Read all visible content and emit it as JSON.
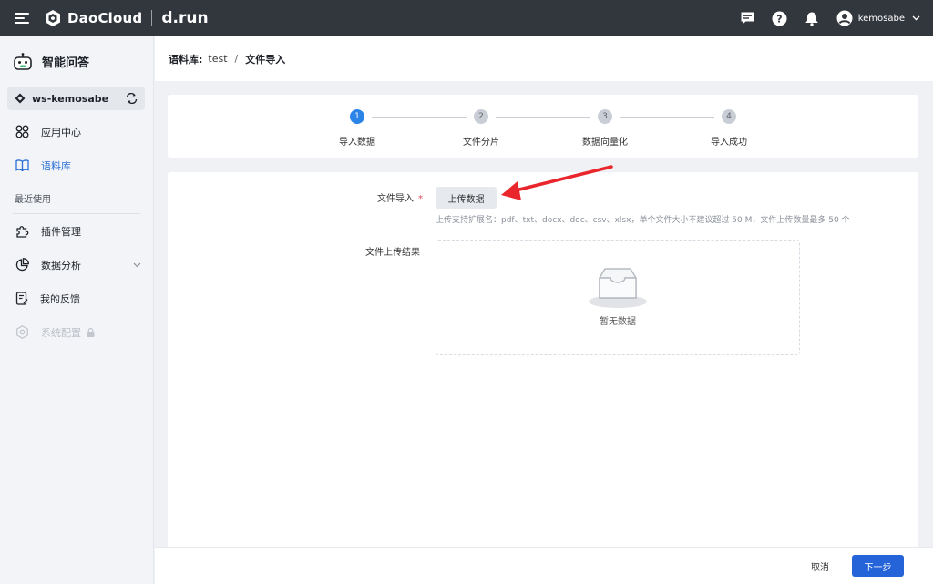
{
  "topbar": {
    "brand": "DaoCloud",
    "product": "d.run",
    "user_name": "kemosabe",
    "icons": [
      "menu-icon",
      "message-icon",
      "help-icon",
      "bell-icon",
      "user-avatar-icon",
      "chevron-down-icon"
    ]
  },
  "sidebar": {
    "app_title": "智能问答",
    "workspace": "ws-kemosabe",
    "items": [
      {
        "label": "应用中心",
        "icon": "apps-icon",
        "state": "normal"
      },
      {
        "label": "语料库",
        "icon": "book-icon",
        "state": "active"
      }
    ],
    "group_label": "最近使用",
    "recent_items": [
      {
        "label": "插件管理",
        "icon": "plugin-icon",
        "state": "normal"
      },
      {
        "label": "数据分析",
        "icon": "pie-chart-icon",
        "state": "normal",
        "expandable": true
      },
      {
        "label": "我的反馈",
        "icon": "feedback-icon",
        "state": "normal"
      },
      {
        "label": "系统配置",
        "icon": "settings-icon",
        "state": "disabled",
        "locked": true
      }
    ]
  },
  "breadcrumb": {
    "library_label": "语料库:",
    "library_name": "test",
    "separator": "/",
    "current": "文件导入"
  },
  "steps": [
    {
      "number": "1",
      "label": "导入数据",
      "active": true
    },
    {
      "number": "2",
      "label": "文件分片",
      "active": false
    },
    {
      "number": "3",
      "label": "数据向量化",
      "active": false
    },
    {
      "number": "4",
      "label": "导入成功",
      "active": false
    }
  ],
  "form": {
    "file_import_label": "文件导入",
    "required_mark": "*",
    "upload_button": "上传数据",
    "hint": "上传支持扩展名：pdf、txt、docx、doc、csv、xlsx，单个文件大小不建议超过 50 M，文件上传数量最多 50 个",
    "result_label": "文件上传结果",
    "empty_text": "暂无数据"
  },
  "footer": {
    "cancel": "取消",
    "next": "下一步"
  },
  "colors": {
    "topbar": "#32363d",
    "primary": "#2563d9",
    "active_step": "#2b84e8",
    "annotation_arrow": "#e8262b"
  }
}
